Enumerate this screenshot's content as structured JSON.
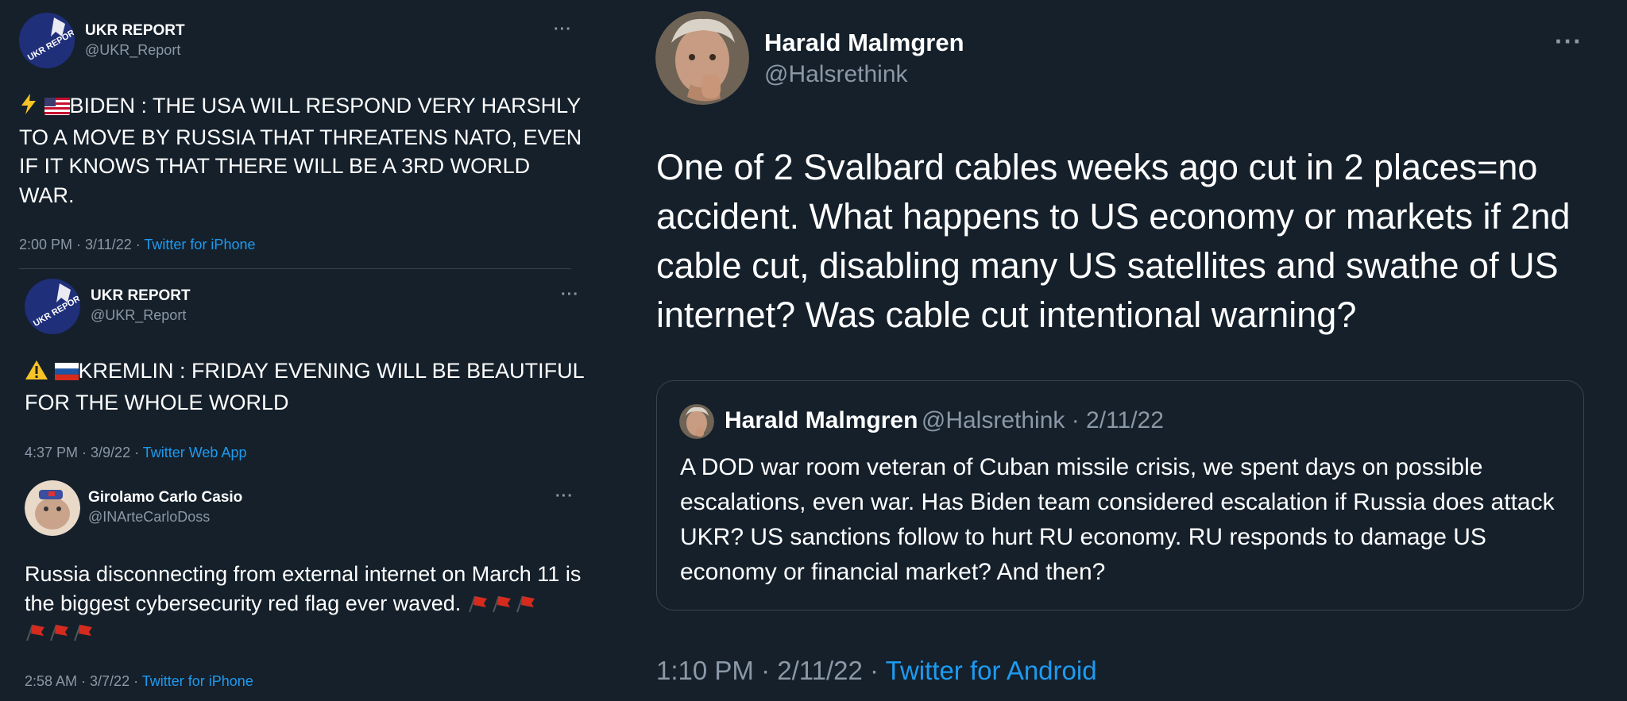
{
  "left_tweets": [
    {
      "author": "UKR REPORT",
      "handle": "@UKR_Report",
      "text": "BIDEN : THE USA WILL RESPOND VERY HARSHLY TO A MOVE BY RUSSIA THAT THREATENS NATO, EVEN IF IT KNOWS THAT THERE WILL BE A 3RD WORLD WAR.",
      "time": "2:00 PM · 3/11/22 · ",
      "source": "Twitter for iPhone",
      "more": "···",
      "avatar_text": "UKR REPORT"
    },
    {
      "author": "UKR REPORT",
      "handle": "@UKR_Report",
      "text": "KREMLIN : FRIDAY EVENING WILL BE BEAUTIFUL FOR THE WHOLE WORLD",
      "time": "4:37 PM · 3/9/22 · ",
      "source": "Twitter Web App",
      "more": "···",
      "avatar_text": "UKR REPORT"
    },
    {
      "author": "Girolamo Carlo Casio",
      "handle": "@INArteCarloDoss",
      "text": "Russia disconnecting from external internet on March 11 is the biggest cybersecurity red flag ever waved.",
      "time": "2:58 AM · 3/7/22 · ",
      "source": "Twitter for iPhone",
      "more": "···"
    }
  ],
  "main_tweet": {
    "author": "Harald Malmgren",
    "handle": "@Halsrethink",
    "text": "One of 2 Svalbard cables weeks ago cut in 2 places=no accident. What happens to US economy or markets if 2nd cable cut, disabling many US satellites and swathe of US internet? Was cable cut intentional warning?",
    "more": "···",
    "time": "1:10 PM · 2/11/22 · ",
    "source": "Twitter for Android",
    "quote": {
      "author": "Harald Malmgren",
      "handle_date": "@Halsrethink · 2/11/22",
      "text": "A DOD war room veteran of Cuban missile crisis, we spent days on possible escalations, even war. Has Biden team considered escalation if Russia does attack UKR? US sanctions follow to hurt RU economy. RU responds to damage US economy or financial market? And then?"
    }
  },
  "colors": {
    "background": "#15202b",
    "text": "#ffffff",
    "muted": "#8b98a5",
    "link": "#1d9bf0",
    "border": "#38444d"
  },
  "icons": [
    "lightning-icon",
    "us-flag-icon",
    "warning-icon",
    "russia-flag-icon",
    "red-flag-icon",
    "more-icon"
  ]
}
